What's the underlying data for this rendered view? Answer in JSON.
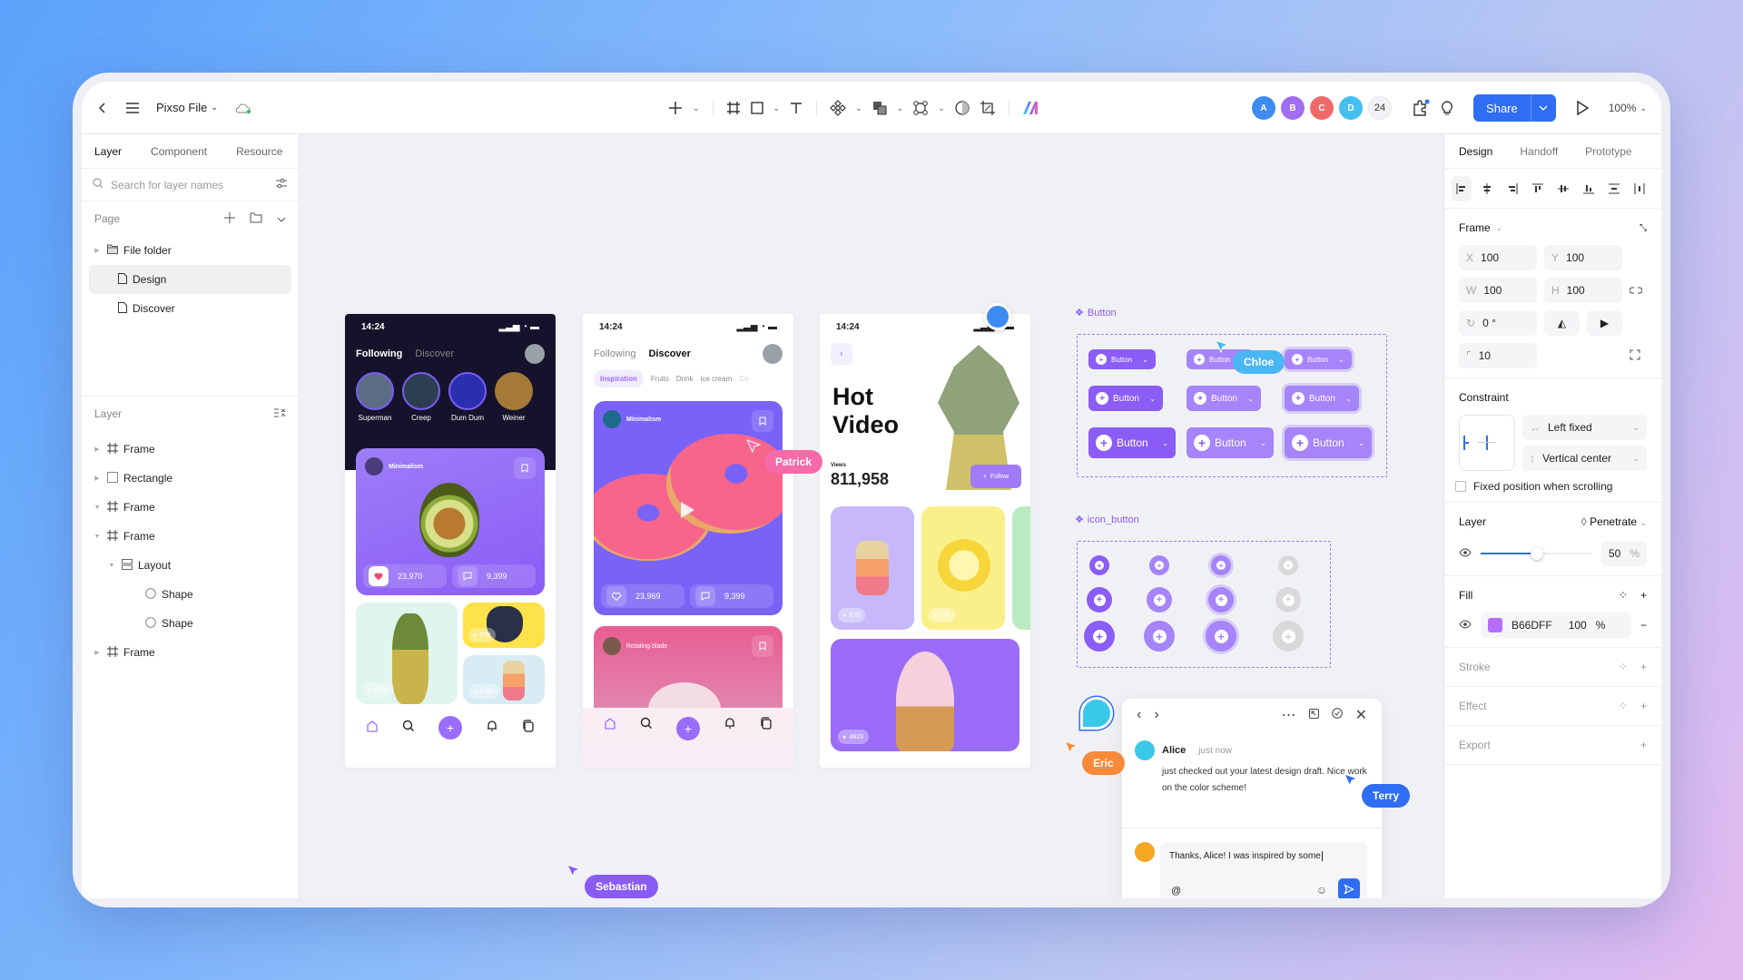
{
  "topbar": {
    "file_name": "Pixso File",
    "collab_count": "24",
    "share_label": "Share",
    "zoom_level": "100%",
    "collaborators": [
      {
        "initial": "A",
        "color": "#3d8bf0"
      },
      {
        "initial": "B",
        "color": "#a06cf0"
      },
      {
        "initial": "C",
        "color": "#f06a6a"
      },
      {
        "initial": "D",
        "color": "#44c0f0"
      }
    ],
    "tools": [
      "add-icon",
      "frame-icon",
      "rectangle-icon",
      "text-icon",
      "component-icon",
      "boolean-icon",
      "vector-icon",
      "mask-icon",
      "crop-icon",
      "ai-logo-icon"
    ]
  },
  "left_panel": {
    "tabs": [
      "Layer",
      "Component",
      "Resource"
    ],
    "search_placeholder": "Search for layer names",
    "page_header": "Page",
    "pages": [
      {
        "label": "File folder",
        "type": "folder"
      },
      {
        "label": "Design",
        "type": "page",
        "selected": true
      },
      {
        "label": "Discover",
        "type": "page"
      }
    ],
    "layer_header": "Layer",
    "layers": [
      {
        "label": "Frame",
        "icon": "frame",
        "indent": 0,
        "caret": "right"
      },
      {
        "label": "Rectangle",
        "icon": "rect",
        "indent": 0,
        "caret": "right"
      },
      {
        "label": "Frame",
        "icon": "frame",
        "indent": 0,
        "caret": "down"
      },
      {
        "label": "Frame",
        "icon": "frame",
        "indent": 0,
        "caret": "down"
      },
      {
        "label": "Layout",
        "icon": "layout",
        "indent": 1,
        "caret": "down"
      },
      {
        "label": "Shape",
        "icon": "circle",
        "indent": 2,
        "caret": ""
      },
      {
        "label": "Shape",
        "icon": "circle",
        "indent": 2,
        "caret": ""
      },
      {
        "label": "Frame",
        "icon": "frame",
        "indent": 0,
        "caret": "right"
      }
    ]
  },
  "right_panel": {
    "tabs": [
      "Design",
      "Handoff",
      "Prototype"
    ],
    "frame_label": "Frame",
    "x": "100",
    "y": "100",
    "w": "100",
    "h": "100",
    "rotation": "0 °",
    "radius": "10",
    "constraint_title": "Constraint",
    "constraint_h": "Left fixed",
    "constraint_v": "Vertical center",
    "fixed_scroll_label": "Fixed position when scrolling",
    "layer_title": "Layer",
    "blend_mode": "Penetrate",
    "opacity": "50",
    "opacity_fraction": 0.5,
    "fill_title": "Fill",
    "fill_hex": "B66DFF",
    "fill_color": "#B66DFF",
    "fill_opacity": "100",
    "percent": "%",
    "stroke_title": "Stroke",
    "effect_title": "Effect",
    "export_title": "Export"
  },
  "canvas": {
    "phone1": {
      "time": "14:24",
      "tab_active": "Following",
      "tab_other": "Discover",
      "stories": [
        "Superman",
        "Creep",
        "Dum Dum",
        "Weiner"
      ],
      "card_title": "Minimalism",
      "likes": "23,970",
      "comments": "9,399",
      "tile_counts": [
        "4820",
        "678",
        "6780"
      ]
    },
    "phone2": {
      "time": "14:24",
      "tab_other": "Following",
      "tab_active": "Discover",
      "chips": [
        "Inspiration",
        "Fruits",
        "Drink",
        "ice cream",
        "Co"
      ],
      "card_title": "Minimalism",
      "likes": "23,969",
      "comments": "9,399",
      "card2_title": "Rotating blade"
    },
    "phone3": {
      "time": "14:24",
      "title_line1": "Hot",
      "title_line2": "Video",
      "views_label": "Views",
      "views": "811,958",
      "follow_label": "Follow",
      "tile_counts": [
        "670",
        "346",
        "4820"
      ]
    },
    "button_component_label": "Button",
    "button_label": "Button",
    "icon_button_component_label": "icon_button",
    "cursors": [
      {
        "name": "Chloe",
        "color": "#4ab7f5"
      },
      {
        "name": "Patrick",
        "color": "#f76aa8"
      },
      {
        "name": "Eric",
        "color": "#f78a3a"
      },
      {
        "name": "Terry",
        "color": "#2f6ef3"
      },
      {
        "name": "Sebastian",
        "color": "#8a5cf6"
      }
    ]
  },
  "comment": {
    "author": "Alice",
    "time": "just now",
    "message": "just checked out your latest design draft. Nice work on the color scheme!",
    "reply_text": "Thanks, Alice! I was inspired by some",
    "mention_symbol": "@"
  }
}
